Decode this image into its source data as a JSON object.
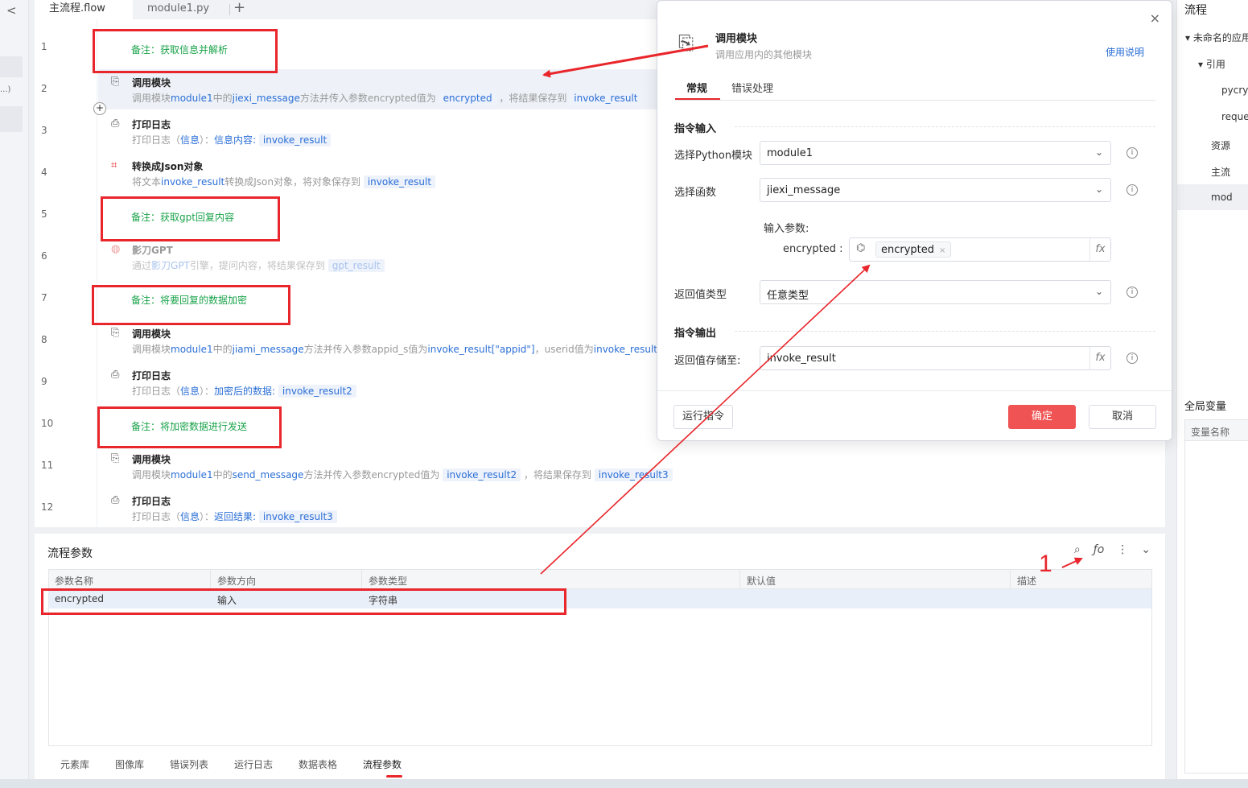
{
  "tabs": {
    "main": "主流程.flow",
    "module": "module1.py",
    "add": "+"
  },
  "left": {
    "chevron": "<",
    "dots": "...)"
  },
  "flow": {
    "line_numbers": [
      "1",
      "2",
      "3",
      "4",
      "5",
      "6",
      "7",
      "8",
      "9",
      "10",
      "11",
      "12"
    ],
    "notes": {
      "n1": "备注：获取信息并解析",
      "n5": "备注：获取gpt回复内容",
      "n7": "备注：将要回复的数据加密",
      "n10": "备注：将加密数据进行发送"
    },
    "steps": {
      "s2": {
        "title": "调用模块",
        "d1": "调用模块",
        "d2": "module1",
        "d3": "中的",
        "d4": "jiexi_message",
        "d5": "方法并传入参数encrypted值为",
        "v1": "encrypted",
        "d6": "，将结果保存到",
        "v2": "invoke_result"
      },
      "s3": {
        "title": "打印日志",
        "d1": "打印日志（",
        "d2": "信息",
        "d3": "）：",
        "d4": "信息内容:",
        "v1": "invoke_result"
      },
      "s4": {
        "title": "转换成Json对象",
        "d1": "将文本",
        "d2": "invoke_result",
        "d3": "转换成Json对象，将对象保存到",
        "v1": "invoke_result"
      },
      "s6": {
        "title": "影刀GPT",
        "d1": "通过",
        "d2": "影刀GPT",
        "d3": "引擎，提问内容，将结果保存到",
        "v1": "gpt_result"
      },
      "s8": {
        "title": "调用模块",
        "d1": "调用模块",
        "d2": "module1",
        "d3": "中的",
        "d4": "jiami_message",
        "d5": "方法并传入参数appid_s值为",
        "d6": "invoke_result[\"appid\"]",
        "d7": "，userid值为",
        "d8": "invoke_result[\"op"
      },
      "s9": {
        "title": "打印日志",
        "d1": "打印日志（",
        "d2": "信息",
        "d3": "）：",
        "d4": "加密后的数据:",
        "v1": "invoke_result2"
      },
      "s11": {
        "title": "调用模块",
        "d1": "调用模块",
        "d2": "module1",
        "d3": "中的",
        "d4": "send_message",
        "d5": "方法并传入参数encrypted值为",
        "v1": "invoke_result2",
        "d6": "，将结果保存到",
        "v2": "invoke_result3"
      },
      "s12": {
        "title": "打印日志",
        "d1": "打印日志（",
        "d2": "信息",
        "d3": "）：",
        "d4": "返回结果:",
        "v1": "invoke_result3"
      }
    },
    "plus": "+"
  },
  "params": {
    "title": "流程参数",
    "tools": [
      "search-icon",
      "function-icon",
      "more-icon",
      "collapse-icon"
    ],
    "tool_glyphs": {
      "search": "⌕",
      "fx": "ƒo",
      "more": "⋮",
      "collapse": "⌄"
    },
    "columns": [
      "参数名称",
      "参数方向",
      "参数类型",
      "默认值",
      "描述"
    ],
    "rows": [
      {
        "name": "encrypted",
        "direction": "输入",
        "type": "字符串",
        "default": "",
        "desc": ""
      }
    ],
    "bottom_tabs": [
      "元素库",
      "图像库",
      "错误列表",
      "运行日志",
      "数据表格",
      "流程参数"
    ]
  },
  "right": {
    "title": "流程",
    "items": [
      "▾ 未命名的应用",
      "▾ 引用",
      "pycry",
      "reque",
      "资源",
      "主流",
      "mod"
    ],
    "global_vars_title": "全局变量",
    "global_vars_col": "变量名称"
  },
  "dialog": {
    "title": "调用模块",
    "subtitle": "调用应用内的其他模块",
    "help": "使用说明",
    "close": "×",
    "tabs": [
      "常规",
      "错误处理"
    ],
    "section_input": "指令输入",
    "section_output": "指令输出",
    "fields": {
      "module_label": "选择Python模块",
      "module_value": "module1",
      "func_label": "选择函数",
      "func_value": "jiexi_message",
      "params_label": "输入参数:",
      "param_name": "encrypted :",
      "param_chip": "encrypted",
      "return_type_label": "返回值类型",
      "return_type_value": "任意类型",
      "return_save_label": "返回值存储至:",
      "return_save_value": "invoke_result"
    },
    "fx": "fx",
    "info": "i",
    "buttons": {
      "run": "运行指令",
      "ok": "确定",
      "cancel": "取消"
    }
  },
  "annotation": {
    "label": "1",
    "color": "#e8262b"
  },
  "colors": {
    "accent": "#f05353",
    "link": "#2b6fd6",
    "note": "#1aa34a",
    "annotation": "#e8262b"
  }
}
